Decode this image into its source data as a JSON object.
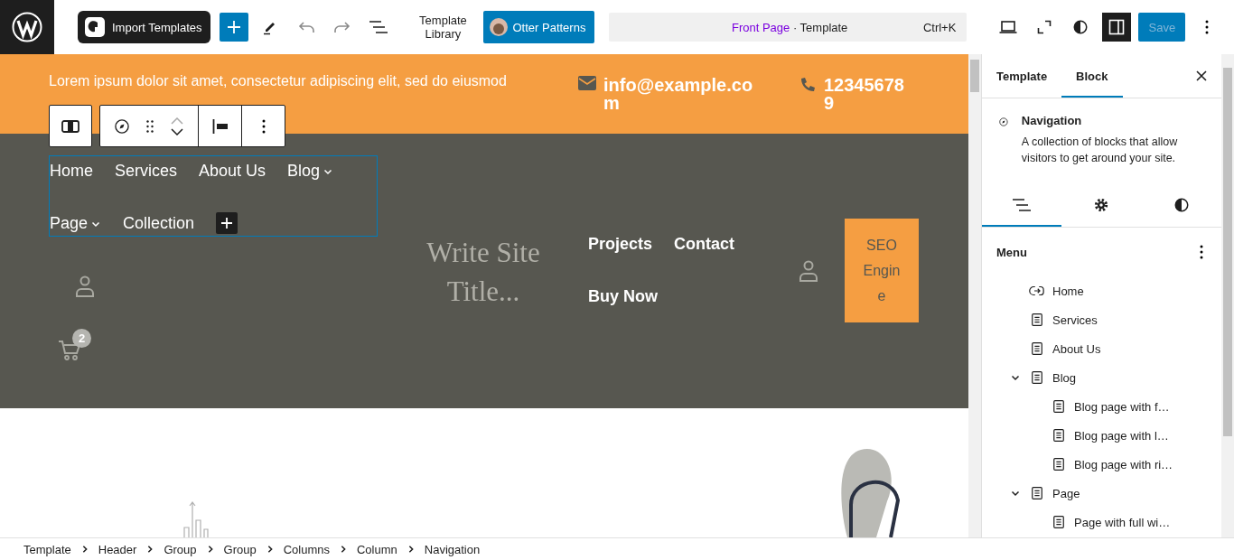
{
  "top_bar": {
    "import_button": "Import Templates",
    "template_library": "Template Library",
    "otter_button": "Otter Patterns",
    "command": {
      "title": "Front Page",
      "type": "· Template",
      "shortcut": "Ctrl+K"
    },
    "sidebar_toggle": {
      "on": true
    },
    "save_button": {
      "label": "Save",
      "disabled": true
    }
  },
  "canvas": {
    "notice": "Lorem ipsum dolor sit amet, consectetur adipiscing elit, sed do eiusmod",
    "email": "info@example.com",
    "phone": "123456789",
    "navigation": [
      {
        "label": "Home",
        "has_submenu": false
      },
      {
        "label": "Services",
        "has_submenu": false
      },
      {
        "label": "About Us",
        "has_submenu": false
      },
      {
        "label": "Blog",
        "has_submenu": true
      },
      {
        "label": "Page",
        "has_submenu": true
      },
      {
        "label": "Collection",
        "has_submenu": false
      }
    ],
    "site_title": "Write Site Title...",
    "secondary_navigation": [
      {
        "label": "Projects"
      },
      {
        "label": "Contact"
      },
      {
        "label": "Buy Now"
      }
    ],
    "cta_button": "SEO Engine",
    "cart_count": "2"
  },
  "sidebar": {
    "tabs": [
      {
        "label": "Template",
        "selected": false
      },
      {
        "label": "Block",
        "selected": true
      }
    ],
    "block": {
      "title": "Navigation",
      "description": "A collection of blocks that allow visitors to get around your site."
    },
    "inspector_tabs": [
      {
        "kind": "list",
        "selected": true
      },
      {
        "kind": "settings",
        "selected": false
      },
      {
        "kind": "styles",
        "selected": false
      }
    ],
    "menu": {
      "title": "Menu",
      "items": [
        {
          "label": "Home",
          "kind": "link"
        },
        {
          "label": "Services",
          "kind": "page"
        },
        {
          "label": "About Us",
          "kind": "page"
        },
        {
          "label": "Blog",
          "kind": "page",
          "expanded": true,
          "children": [
            {
              "label": "Blog page with f…",
              "kind": "page"
            },
            {
              "label": "Blog page with l…",
              "kind": "page"
            },
            {
              "label": "Blog page with ri…",
              "kind": "page"
            }
          ]
        },
        {
          "label": "Page",
          "kind": "page",
          "expanded": true,
          "children": [
            {
              "label": "Page with full wi…",
              "kind": "page"
            }
          ]
        }
      ]
    }
  },
  "breadcrumb": [
    "Template",
    "Header",
    "Group",
    "Group",
    "Columns",
    "Column",
    "Navigation"
  ]
}
